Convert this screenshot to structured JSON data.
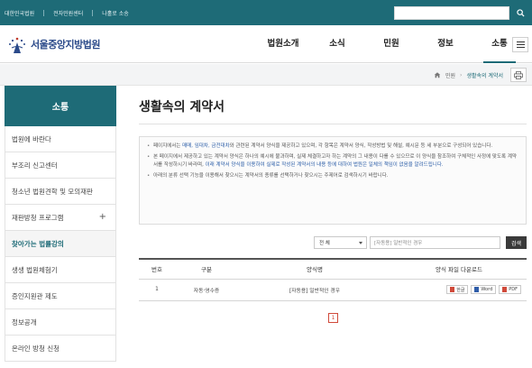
{
  "topbar": {
    "links": [
      "대한민국법원",
      "전자민원센터",
      "나홀로 소송"
    ],
    "search_placeholder": ""
  },
  "header": {
    "court_name": "서울중앙지방법원",
    "nav": [
      "법원소개",
      "소식",
      "민원",
      "정보",
      "소통"
    ],
    "active_nav": "소통"
  },
  "breadcrumb": {
    "home": "민원",
    "current": "생활속의 계약서"
  },
  "sidebar": {
    "title": "소통",
    "items": [
      {
        "label": "법원에 바란다"
      },
      {
        "label": "부조리 신고센터"
      },
      {
        "label": "청소년 법원견학 및 모의재판"
      },
      {
        "label": "재판방청 프로그램",
        "plus": "+"
      },
      {
        "label": "찾아가는 법률강의"
      },
      {
        "label": "생생 법원체험기"
      },
      {
        "label": "증인지원관 제도"
      },
      {
        "label": "정보공개"
      },
      {
        "label": "온라인 방청 신청"
      }
    ]
  },
  "main": {
    "title": "생활속의 계약서",
    "guide": {
      "p1_a": "페이지에서는 ",
      "p1_link": "매매, 임대차, 금전대차",
      "p1_b": "와 관련된 계약서 양식을 제공하고 있으며, 각 항목은 계약서 양식, 작성방법 및 해설, 예시문 등 세 부분으로 구성되어 있습니다.",
      "p2_a": "본 페이지에서 제공하고 있는 계약서 양식은 하나의 예시에 불과하며, 실제 체결하고자 하는 계약의 그 내용이 다를 수 있으므로 이 양식을 참조하여 구체적인 사정에 맞도록 계약서를 작성하시기 바라며, ",
      "p2_link": "이래 계약서 양식을 이용하여 실제로 작성된 계약서의 내용 등에 대하여 법원은 일체의 책임이 없음을 알려드립니다.",
      "p3": "아래의 분류 선택 기능을 이용해서 찾으시는 계약서의 종류를 선택하거나 찾으시는 주제어로 검색하시기 바랍니다."
    },
    "filter": {
      "select_value": "전 체",
      "keyword_placeholder": "[자동용] 일반적인 경우",
      "button": "검색"
    },
    "table": {
      "headers": [
        "번호",
        "구분",
        "양식명",
        "양식 파일 다운로드"
      ],
      "rows": [
        {
          "no": "1",
          "category": "자동·영수증",
          "name": "[자동용] 일반적인 경우",
          "files": [
            "한글",
            "Word",
            "PDF"
          ]
        }
      ]
    },
    "pager": {
      "current": "1"
    }
  },
  "colors": {
    "brand": "#1e6b77",
    "accent": "#d04a3a"
  }
}
